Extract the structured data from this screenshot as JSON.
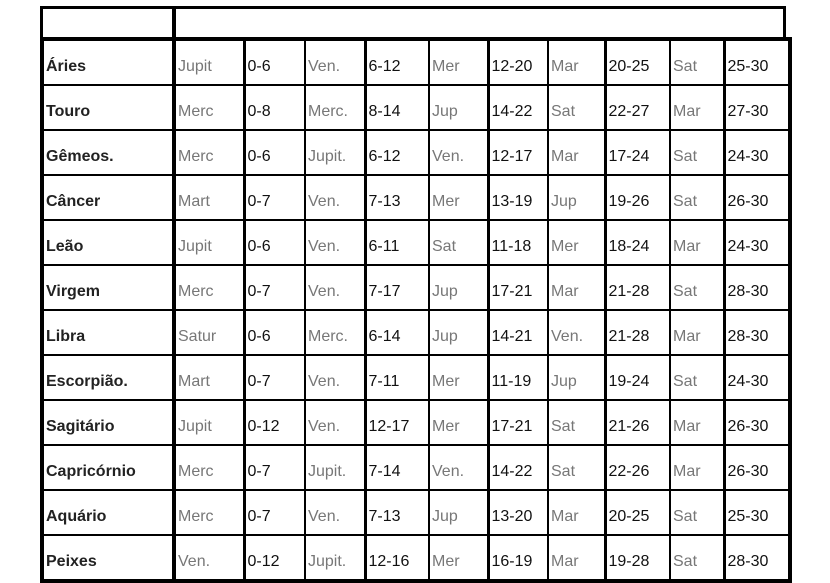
{
  "rows": [
    {
      "sign": "Áries",
      "cells": [
        "Jupit",
        "0-6",
        "Ven.",
        "6-12",
        "Mer",
        "12-20",
        "Mar",
        "20-25",
        "Sat",
        "25-30"
      ]
    },
    {
      "sign": "Touro",
      "cells": [
        "Merc",
        "0-8",
        "Merc.",
        "8-14",
        "Jup",
        "14-22",
        "Sat",
        "22-27",
        "Mar",
        "27-30"
      ]
    },
    {
      "sign": "Gêmeos.",
      "cells": [
        "Merc",
        "0-6",
        "Jupit.",
        "6-12",
        "Ven.",
        "12-17",
        "Mar",
        "17-24",
        "Sat",
        "24-30"
      ]
    },
    {
      "sign": "Câncer",
      "cells": [
        "Mart",
        "0-7",
        "Ven.",
        "7-13",
        "Mer",
        "13-19",
        "Jup",
        "19-26",
        "Sat",
        "26-30"
      ]
    },
    {
      "sign": "Leão",
      "cells": [
        "Jupit",
        "0-6",
        "Ven.",
        "6-11",
        "Sat",
        "11-18",
        "Mer",
        "18-24",
        "Mar",
        "24-30"
      ]
    },
    {
      "sign": "Virgem",
      "cells": [
        "Merc",
        "0-7",
        "Ven.",
        "7-17",
        "Jup",
        "17-21",
        "Mar",
        "21-28",
        "Sat",
        "28-30"
      ]
    },
    {
      "sign": "Libra",
      "cells": [
        "Satur",
        "0-6",
        "Merc.",
        "6-14",
        "Jup",
        "14-21",
        "Ven.",
        "21-28",
        "Mar",
        "28-30"
      ]
    },
    {
      "sign": "Escorpião.",
      "cells": [
        "Mart",
        "0-7",
        "Ven.",
        "7-11",
        "Mer",
        "11-19",
        "Jup",
        "19-24",
        "Sat",
        "24-30"
      ]
    },
    {
      "sign": "Sagitário",
      "cells": [
        "Jupit",
        "0-12",
        "Ven.",
        "12-17",
        "Mer",
        "17-21",
        "Sat",
        "21-26",
        "Mar",
        "26-30"
      ]
    },
    {
      "sign": "Capricórnio",
      "cells": [
        "Merc",
        "0-7",
        "Jupit.",
        "7-14",
        "Ven.",
        "14-22",
        "Sat",
        "22-26",
        "Mar",
        "26-30"
      ]
    },
    {
      "sign": "Aquário",
      "cells": [
        "Merc",
        "0-7",
        "Ven.",
        "7-13",
        "Jup",
        "13-20",
        "Mar",
        "20-25",
        "Sat",
        "25-30"
      ]
    },
    {
      "sign": "Peixes",
      "cells": [
        "Ven.",
        "0-12",
        "Jupit.",
        "12-16",
        "Mer",
        "16-19",
        "Mar",
        "19-28",
        "Sat",
        "28-30"
      ]
    }
  ]
}
